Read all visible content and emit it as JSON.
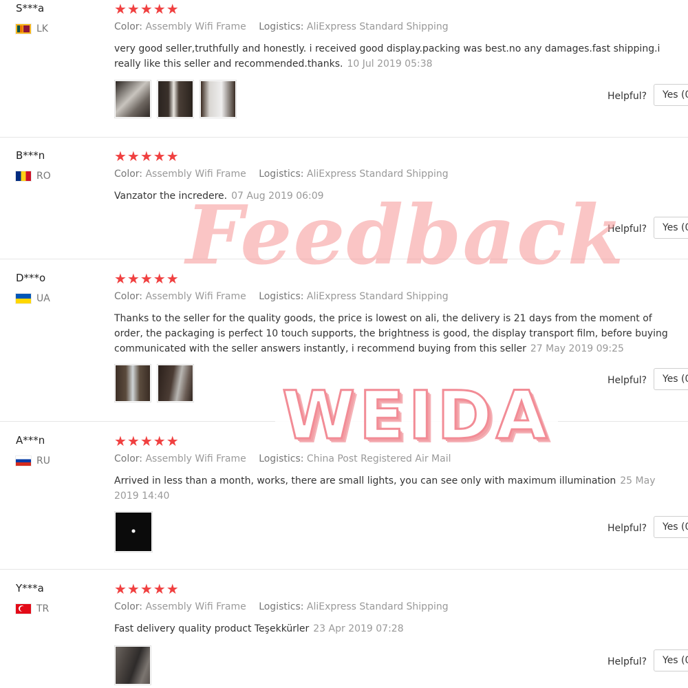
{
  "labels": {
    "color": "Color:",
    "logistics": "Logistics:",
    "helpful": "Helpful?",
    "yes": "Yes (0"
  },
  "stars": "★★★★★",
  "reviews": [
    {
      "user": "S***a",
      "country": "LK",
      "color": "Assembly Wifi Frame",
      "logistics": "AliExpress Standard Shipping",
      "text": "very good seller,truthfully and honestly. i received good display.packing was best.no any damages.fast shipping.i really like this seller and recommended.thanks.",
      "date": "10 Jul 2019 05:38",
      "photos": 3
    },
    {
      "user": "B***n",
      "country": "RO",
      "color": "Assembly Wifi Frame",
      "logistics": "AliExpress Standard Shipping",
      "text": "Vanzator the incredere.",
      "date": "07 Aug 2019 06:09",
      "photos": 0
    },
    {
      "user": "D***o",
      "country": "UA",
      "color": "Assembly Wifi Frame",
      "logistics": "AliExpress Standard Shipping",
      "text": "Thanks to the seller for the quality goods, the price is lowest on ali, the delivery is 21 days from the moment of order, the packaging is perfect 10 touch supports, the brightness is good, the display transport film, before buying communicated with the seller answers instantly, i recommend buying from this seller",
      "date": "27 May 2019 09:25",
      "photos": 2
    },
    {
      "user": "A***n",
      "country": "RU",
      "color": "Assembly Wifi Frame",
      "logistics": "China Post Registered Air Mail",
      "text": "Arrived in less than a month, works, there are small lights, you can see only with maximum illumination",
      "date": "25 May 2019 14:40",
      "photos": 1
    },
    {
      "user": "Y***a",
      "country": "TR",
      "color": "Assembly Wifi Frame",
      "logistics": "AliExpress Standard Shipping",
      "text": "Fast delivery quality product Teşekkürler",
      "date": "23 Apr 2019 07:28",
      "photos": 1
    }
  ],
  "watermark": {
    "feedback": "Feedback",
    "brand": "WEIDA"
  }
}
